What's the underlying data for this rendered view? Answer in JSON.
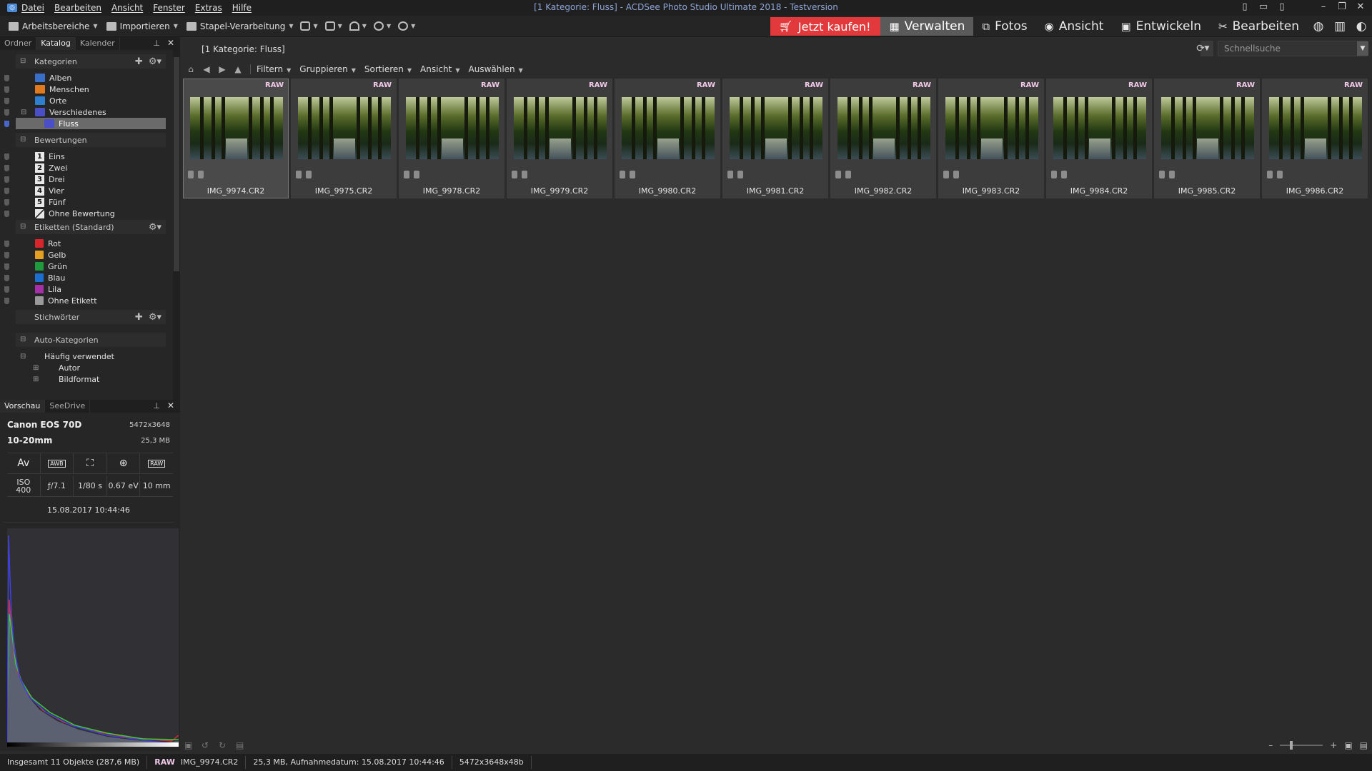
{
  "window": {
    "title": "[1 Kategorie: Fluss] - ACDSee Photo Studio Ultimate 2018 - Testversion"
  },
  "menu": [
    "Datei",
    "Bearbeiten",
    "Ansicht",
    "Fenster",
    "Extras",
    "Hilfe"
  ],
  "toolbar": {
    "workspaces": "Arbeitsbereiche",
    "import": "Importieren",
    "batch": "Stapel-Verarbeitung"
  },
  "modes": {
    "buy": "Jetzt kaufen!",
    "manage": "Verwalten",
    "photos": "Fotos",
    "view": "Ansicht",
    "develop": "Entwickeln",
    "edit": "Bearbeiten"
  },
  "left_tabs": [
    "Ordner",
    "Katalog",
    "Kalender"
  ],
  "catalog": {
    "categories_title": "Kategorien",
    "categories": [
      {
        "label": "Alben",
        "color": "#3a6fc8"
      },
      {
        "label": "Menschen",
        "color": "#e07a1f"
      },
      {
        "label": "Orte",
        "color": "#2e7fd0"
      },
      {
        "label": "Verschiedenes",
        "color": "#4a4fc8"
      },
      {
        "label": "Fluss",
        "color": "#4a4fc8"
      }
    ],
    "ratings_title": "Bewertungen",
    "ratings": [
      {
        "num": "1",
        "label": "Eins"
      },
      {
        "num": "2",
        "label": "Zwei"
      },
      {
        "num": "3",
        "label": "Drei"
      },
      {
        "num": "4",
        "label": "Vier"
      },
      {
        "num": "5",
        "label": "Fünf"
      },
      {
        "num": "",
        "label": "Ohne Bewertung"
      }
    ],
    "labels_title": "Etiketten (Standard)",
    "labels": [
      {
        "label": "Rot",
        "color": "#d8262c"
      },
      {
        "label": "Gelb",
        "color": "#e6a021"
      },
      {
        "label": "Grün",
        "color": "#1f9a3c"
      },
      {
        "label": "Blau",
        "color": "#1c6fd0"
      },
      {
        "label": "Lila",
        "color": "#a42fa8"
      },
      {
        "label": "Ohne Etikett",
        "color": "#9a9a9a"
      }
    ],
    "keywords_title": "Stichwörter",
    "auto_title": "Auto-Kategorien",
    "auto": [
      {
        "label": "Häufig verwendet",
        "level": 0
      },
      {
        "label": "Autor",
        "level": 1
      },
      {
        "label": "Bildformat",
        "level": 1
      }
    ]
  },
  "preview_tabs": [
    "Vorschau",
    "SeeDrive"
  ],
  "preview": {
    "camera": "Canon EOS 70D",
    "lens": "10-20mm",
    "dimensions": "5472x3648",
    "size": "25,3 MB",
    "iso_label": "ISO",
    "iso": "400",
    "aperture": "ƒ/7.1",
    "shutter": "1/80 s",
    "ev": "0.67 eV",
    "focal": "10 mm",
    "date": "15.08.2017 10:44:46",
    "awb": "AWB",
    "raw": "RAW",
    "mode": "Av"
  },
  "content": {
    "breadcrumb": "[1 Kategorie: Fluss]",
    "quick_search": "Schnellsuche",
    "nav_menus": [
      "Filtern",
      "Gruppieren",
      "Sortieren",
      "Ansicht",
      "Auswählen"
    ],
    "badge": "RAW",
    "files": [
      "IMG_9974.CR2",
      "IMG_9975.CR2",
      "IMG_9978.CR2",
      "IMG_9979.CR2",
      "IMG_9980.CR2",
      "IMG_9981.CR2",
      "IMG_9982.CR2",
      "IMG_9983.CR2",
      "IMG_9984.CR2",
      "IMG_9985.CR2",
      "IMG_9986.CR2"
    ]
  },
  "status": {
    "total": "Insgesamt 11 Objekte  (287,6 MB)",
    "raw": "RAW",
    "file": "IMG_9974.CR2",
    "info": "25,3 MB, Aufnahmedatum: 15.08.2017 10:44:46",
    "dims": "5472x3648x48b"
  }
}
